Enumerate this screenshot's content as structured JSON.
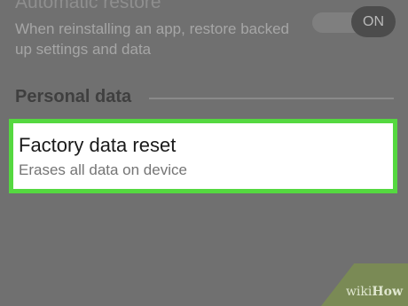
{
  "automatic_restore": {
    "title": "Automatic restore",
    "description": "When reinstalling an app, restore backed up settings and data",
    "toggle_state": "ON"
  },
  "personal_data": {
    "header": "Personal data"
  },
  "factory_reset": {
    "title": "Factory data reset",
    "description": "Erases all data on device"
  },
  "highlight_color": "#55d840",
  "watermark": {
    "wiki": "wiki",
    "how": "How"
  }
}
